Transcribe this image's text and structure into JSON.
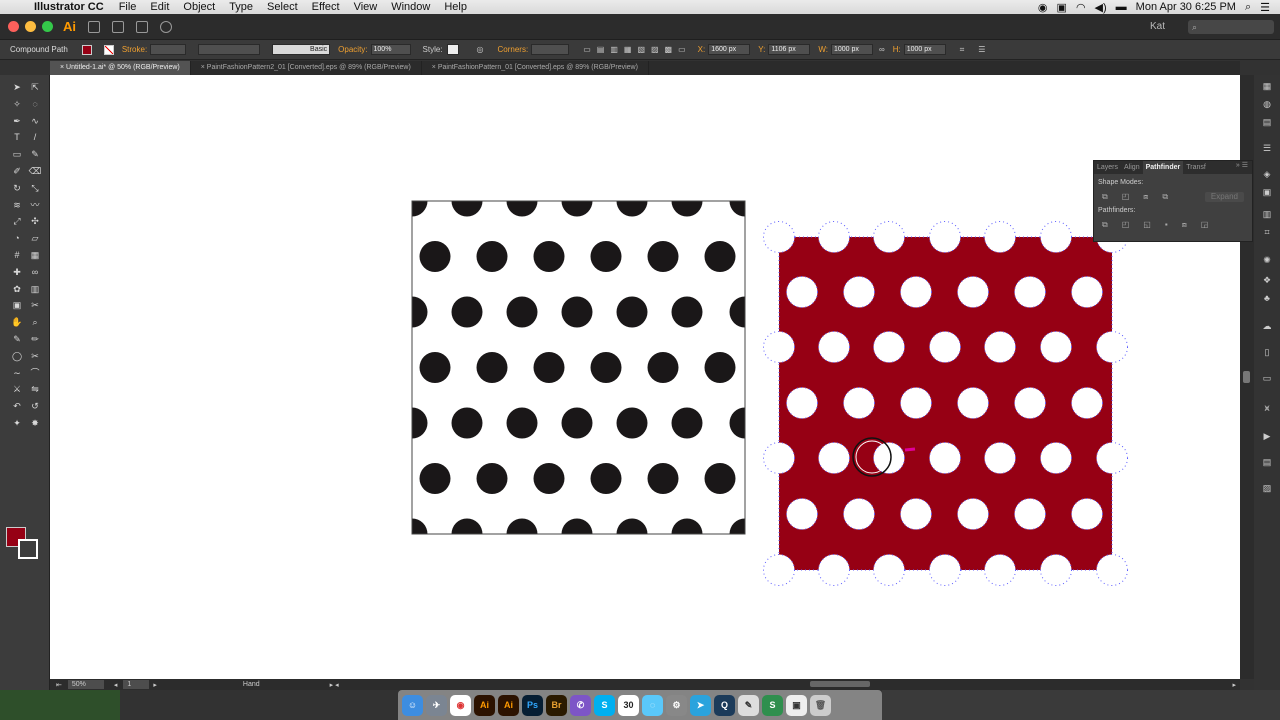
{
  "menubar": {
    "app_name": "Illustrator CC",
    "items": [
      "File",
      "Edit",
      "Object",
      "Type",
      "Select",
      "Effect",
      "View",
      "Window",
      "Help"
    ],
    "clock": "Mon Apr 30  6:25 PM"
  },
  "apptitle": {
    "logo": "Ai",
    "user": "Kat"
  },
  "control": {
    "selection_type": "Compound Path",
    "stroke_label": "Stroke:",
    "brush_label": "Basic",
    "opacity_label": "Opacity:",
    "opacity_value": "100%",
    "style_label": "Style:",
    "corners_label": "Corners:",
    "x_label": "X:",
    "x_value": "1600 px",
    "y_label": "Y:",
    "y_value": "1106 px",
    "w_label": "W:",
    "w_value": "1000 px",
    "h_label": "H:",
    "h_value": "1000 px",
    "fill_color": "#960014"
  },
  "tabs": [
    "Untitled-1.ai* @ 50% (RGB/Preview)",
    "PaintFashionPattern2_01 [Converted].eps @ 89% (RGB/Preview)",
    "PaintFashionPattern_01 [Converted].eps @ 89% (RGB/Preview)"
  ],
  "panel": {
    "tabs": [
      "Layers",
      "Align",
      "Pathfinder",
      "Transf"
    ],
    "shape_modes_label": "Shape Modes:",
    "pathfinders_label": "Pathfinders:",
    "expand_label": "Expand"
  },
  "status": {
    "zoom": "50%",
    "page": "1",
    "tool": "Hand"
  },
  "colors": {
    "pattern_red": "#960014",
    "dot_black": "#1a1718",
    "path_highlight": "#5b5bff"
  },
  "dock": {
    "icons": [
      "finder-icon",
      "launchpad-icon",
      "chrome-icon",
      "illustrator-icon",
      "illustrator-icon",
      "photoshop-icon",
      "bridge-icon",
      "viber-icon",
      "skype-icon",
      "calendar-icon",
      "messages-icon",
      "settings-icon",
      "telegram-icon",
      "quicktime-icon",
      "scripteditor-icon",
      "ui-icon",
      "preview-icon",
      "trash-icon"
    ],
    "calendar_day": "30"
  }
}
